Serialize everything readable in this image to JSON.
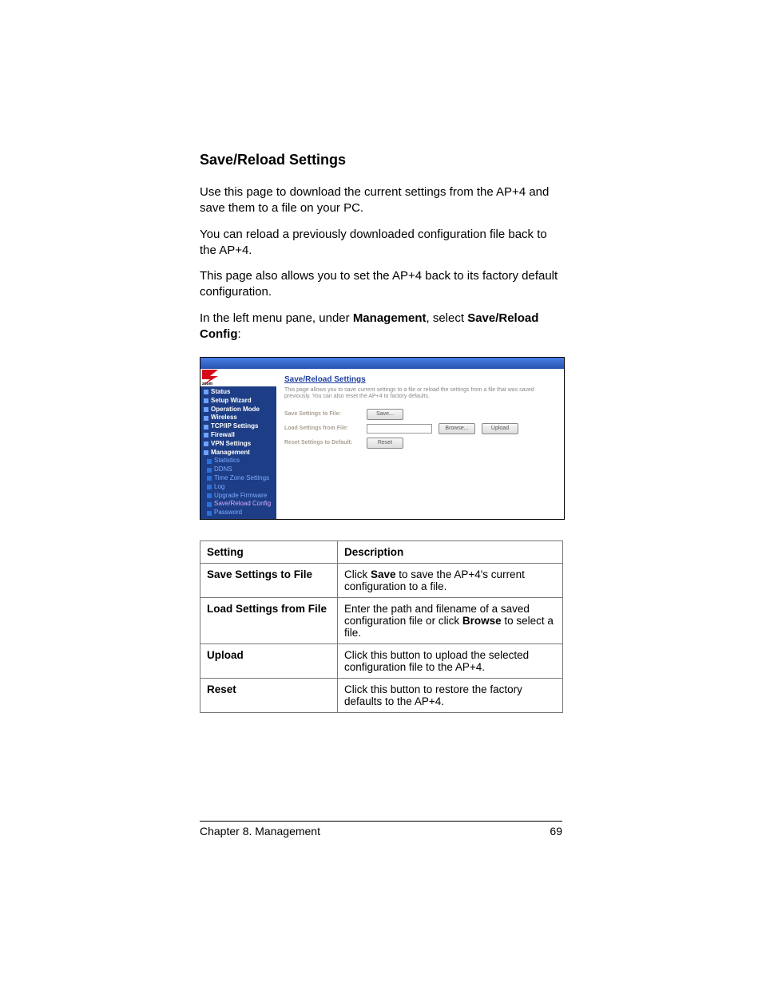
{
  "section_heading": "Save/Reload Settings",
  "para1": "Use this page to download the current settings from the AP+4 and save them to a file on your PC.",
  "para2": "You can reload a previously downloaded configuration file back to the AP+4.",
  "para3": "This page also allows you to set the AP+4 back to its factory default configuration.",
  "para4_a": "In the left menu pane, under ",
  "para4_b": "Management",
  "para4_c": ", select ",
  "para4_d": "Save/Reload Config",
  "para4_e": ":",
  "screenshot": {
    "brand": "zoom",
    "nav": {
      "top": [
        "Status",
        "Setup Wizard",
        "Operation Mode",
        "Wireless",
        "TCP/IP Settings",
        "Firewall",
        "VPN Settings",
        "Management"
      ],
      "sub": [
        "Statistics",
        "DDNS",
        "Time Zone Settings",
        "Log",
        "Upgrade Firmware",
        "Save/Reload Config",
        "Password"
      ]
    },
    "title": "Save/Reload Settings",
    "desc": "This page allows you to save current settings to a file or reload the settings from a file that was saved previously. You can also reset the AP+4 to factory defaults.",
    "rows": {
      "save_label": "Save Settings to File:",
      "save_btn": "Save...",
      "load_label": "Load Settings from File:",
      "browse_btn": "Browse...",
      "upload_btn": "Upload",
      "reset_label": "Reset Settings to Default:",
      "reset_btn": "Reset"
    }
  },
  "table": {
    "h1": "Setting",
    "h2": "Description",
    "rows": [
      {
        "setting": "Save Settings to File",
        "desc_a": "Click ",
        "desc_bold": "Save",
        "desc_b": " to save the AP+4's current configuration to a file."
      },
      {
        "setting": "Load Settings from File",
        "desc_a": "Enter the path and filename of a saved configuration file or click ",
        "desc_bold": "Browse",
        "desc_b": " to select a file."
      },
      {
        "setting": "Upload",
        "desc_a": "Click this button to upload the selected configuration file to the AP+4.",
        "desc_bold": "",
        "desc_b": ""
      },
      {
        "setting": "Reset",
        "desc_a": "Click this button to restore the factory defaults to the AP+4.",
        "desc_bold": "",
        "desc_b": ""
      }
    ]
  },
  "footer": {
    "left": "Chapter 8. Management",
    "right": "69"
  }
}
